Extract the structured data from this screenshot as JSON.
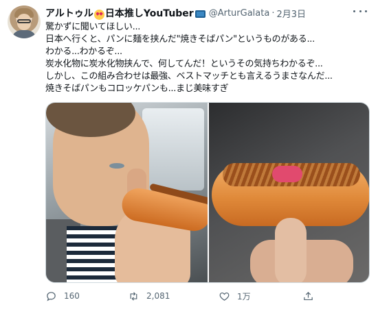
{
  "author": {
    "display_name_part1": "アルトゥル",
    "display_name_part2": "日本推しYouTuber",
    "handle": "@ArturGalata",
    "separator": "·",
    "date": "2月3日"
  },
  "tweet_lines": [
    "驚かずに聞いてほしい...",
    "日本へ行くと、パンに麺を挟んだ\"焼きそばパン\"というものがある...",
    "わかる...わかるぞ...",
    "炭水化物に炭水化物挟んで、何してんだ！というその気持ちわかるぞ...",
    "しかし、この組み合わせは最強、ベストマッチとも言えるうまさなんだ...",
    "焼きそばパンもコロッケパンも...まじ美味すぎ"
  ],
  "actions": {
    "reply_count": "160",
    "retweet_count": "2,081",
    "like_count": "1万"
  },
  "icons": {
    "emoji_1": "heart-eyes-emoji",
    "emoji_2": "television-emoji",
    "reply": "reply-icon",
    "retweet": "retweet-icon",
    "like": "heart-icon",
    "share": "share-icon",
    "more": "more-icon"
  },
  "colors": {
    "text_primary": "#0f1419",
    "text_secondary": "#536471",
    "border": "#cfd9de"
  }
}
